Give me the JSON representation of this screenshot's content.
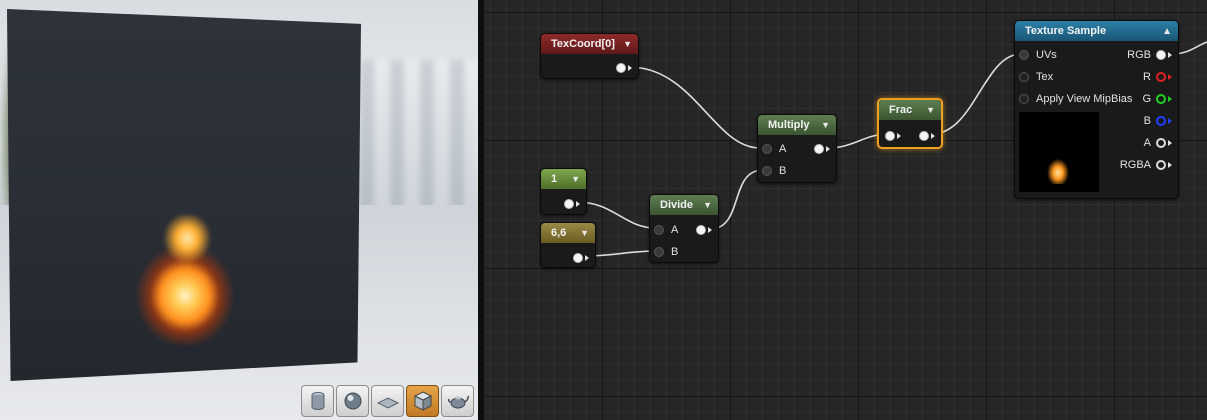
{
  "viewport": {
    "toolbar": [
      {
        "icon": "cylinder-icon",
        "active": false
      },
      {
        "icon": "sphere-icon",
        "active": false
      },
      {
        "icon": "plane-icon",
        "active": false
      },
      {
        "icon": "cube-icon",
        "active": true
      },
      {
        "icon": "teapot-icon",
        "active": false
      }
    ]
  },
  "nodes": {
    "texcoord": {
      "title": "TexCoord[0]"
    },
    "const1": {
      "title": "1"
    },
    "const66": {
      "title": "6,6"
    },
    "divide": {
      "title": "Divide",
      "pin_a": "A",
      "pin_b": "B"
    },
    "multiply": {
      "title": "Multiply",
      "pin_a": "A",
      "pin_b": "B"
    },
    "frac": {
      "title": "Frac"
    },
    "texture_sample": {
      "title": "Texture Sample",
      "inputs": {
        "uvs": "UVs",
        "tex": "Tex",
        "mip": "Apply View MipBias"
      },
      "outputs": {
        "rgb": "RGB",
        "r": "R",
        "g": "G",
        "b": "B",
        "a": "A",
        "rgba": "RGBA"
      }
    }
  },
  "colors": {
    "selection": "#f0a020",
    "r_pin": "#e02020",
    "g_pin": "#20d020",
    "b_pin": "#2040ff"
  }
}
